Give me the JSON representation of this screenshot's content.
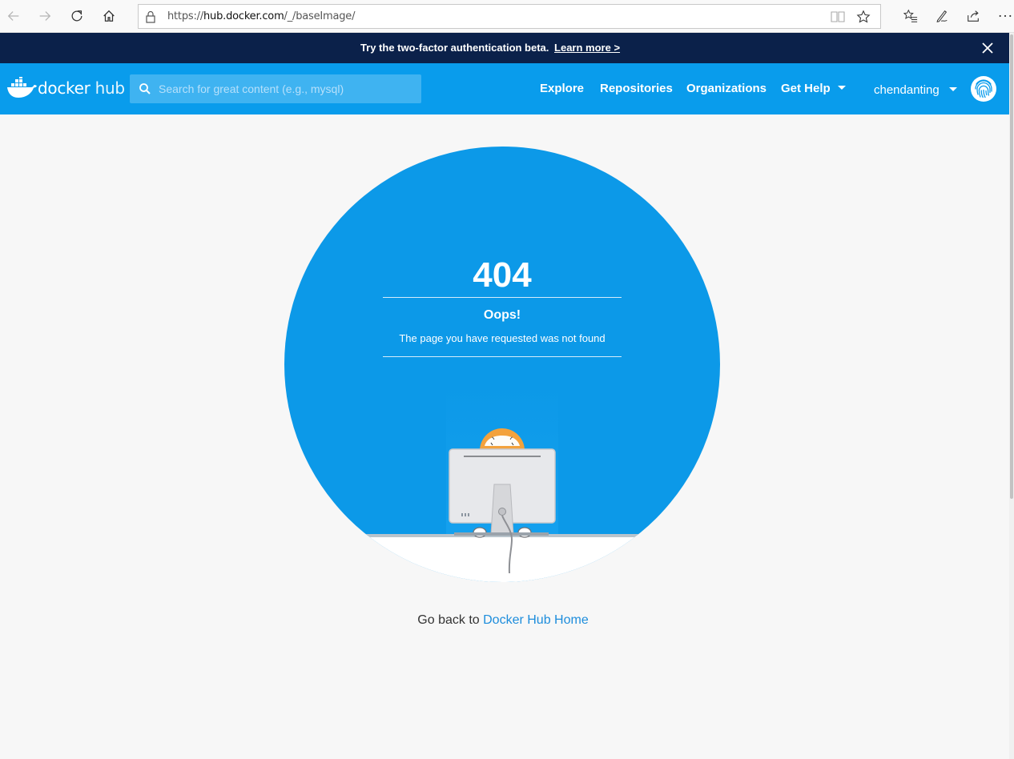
{
  "browser": {
    "url_prefix": "https://",
    "url_host": "hub.docker.com",
    "url_path": "/_/baseImage/"
  },
  "banner": {
    "message": "Try the two-factor authentication beta.",
    "link": "Learn more >"
  },
  "header": {
    "logo_docker": "docker",
    "logo_hub": "hub",
    "search_placeholder": "Search for great content (e.g., mysql)",
    "nav": [
      "Explore",
      "Repositories",
      "Organizations",
      "Get Help"
    ],
    "username": "chendanting"
  },
  "error": {
    "code": "404",
    "title": "Oops!",
    "message": "The page you have requested was not found"
  },
  "footer": {
    "prefix": "Go back to",
    "link": "Docker Hub Home"
  },
  "colors": {
    "banner": "#0b214a",
    "header": "#099cec",
    "circle": "#0c99e8",
    "link": "#1d8ddc"
  },
  "icons": [
    "back-icon",
    "forward-icon",
    "refresh-icon",
    "home-icon",
    "lock-icon",
    "reader-view-icon",
    "favorite-star-icon",
    "favorites-list-icon",
    "pen-icon",
    "share-icon",
    "more-icon",
    "close-icon",
    "docker-whale-logo",
    "search-icon",
    "chevron-down-icon",
    "fingerprint-avatar-icon"
  ]
}
